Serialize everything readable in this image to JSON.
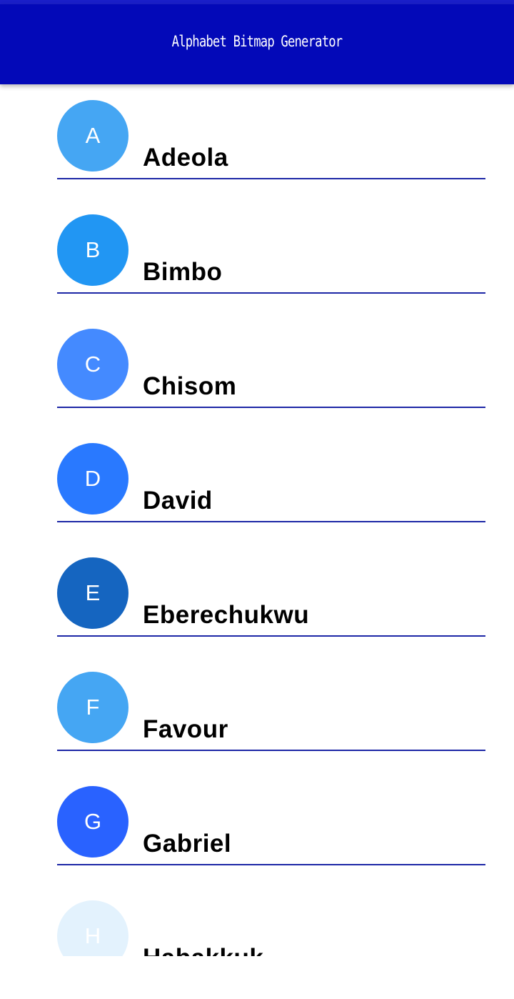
{
  "app_bar": {
    "title": "Alphabet Bitmap Generator",
    "color": "#0309b8"
  },
  "list": {
    "items": [
      {
        "letter": "A",
        "name": "Adeola",
        "avatar_color": "#45a6f3"
      },
      {
        "letter": "B",
        "name": "Bimbo",
        "avatar_color": "#2196f3"
      },
      {
        "letter": "C",
        "name": "Chisom",
        "avatar_color": "#448aff"
      },
      {
        "letter": "D",
        "name": "David",
        "avatar_color": "#2979ff"
      },
      {
        "letter": "E",
        "name": "Eberechukwu",
        "avatar_color": "#1565c0"
      },
      {
        "letter": "F",
        "name": "Favour",
        "avatar_color": "#45a6f3"
      },
      {
        "letter": "G",
        "name": "Gabriel",
        "avatar_color": "#2962ff"
      },
      {
        "letter": "H",
        "name": "Habakkuk",
        "avatar_color": "#e3f2fd"
      }
    ],
    "divider_color": "#1d27a6"
  }
}
